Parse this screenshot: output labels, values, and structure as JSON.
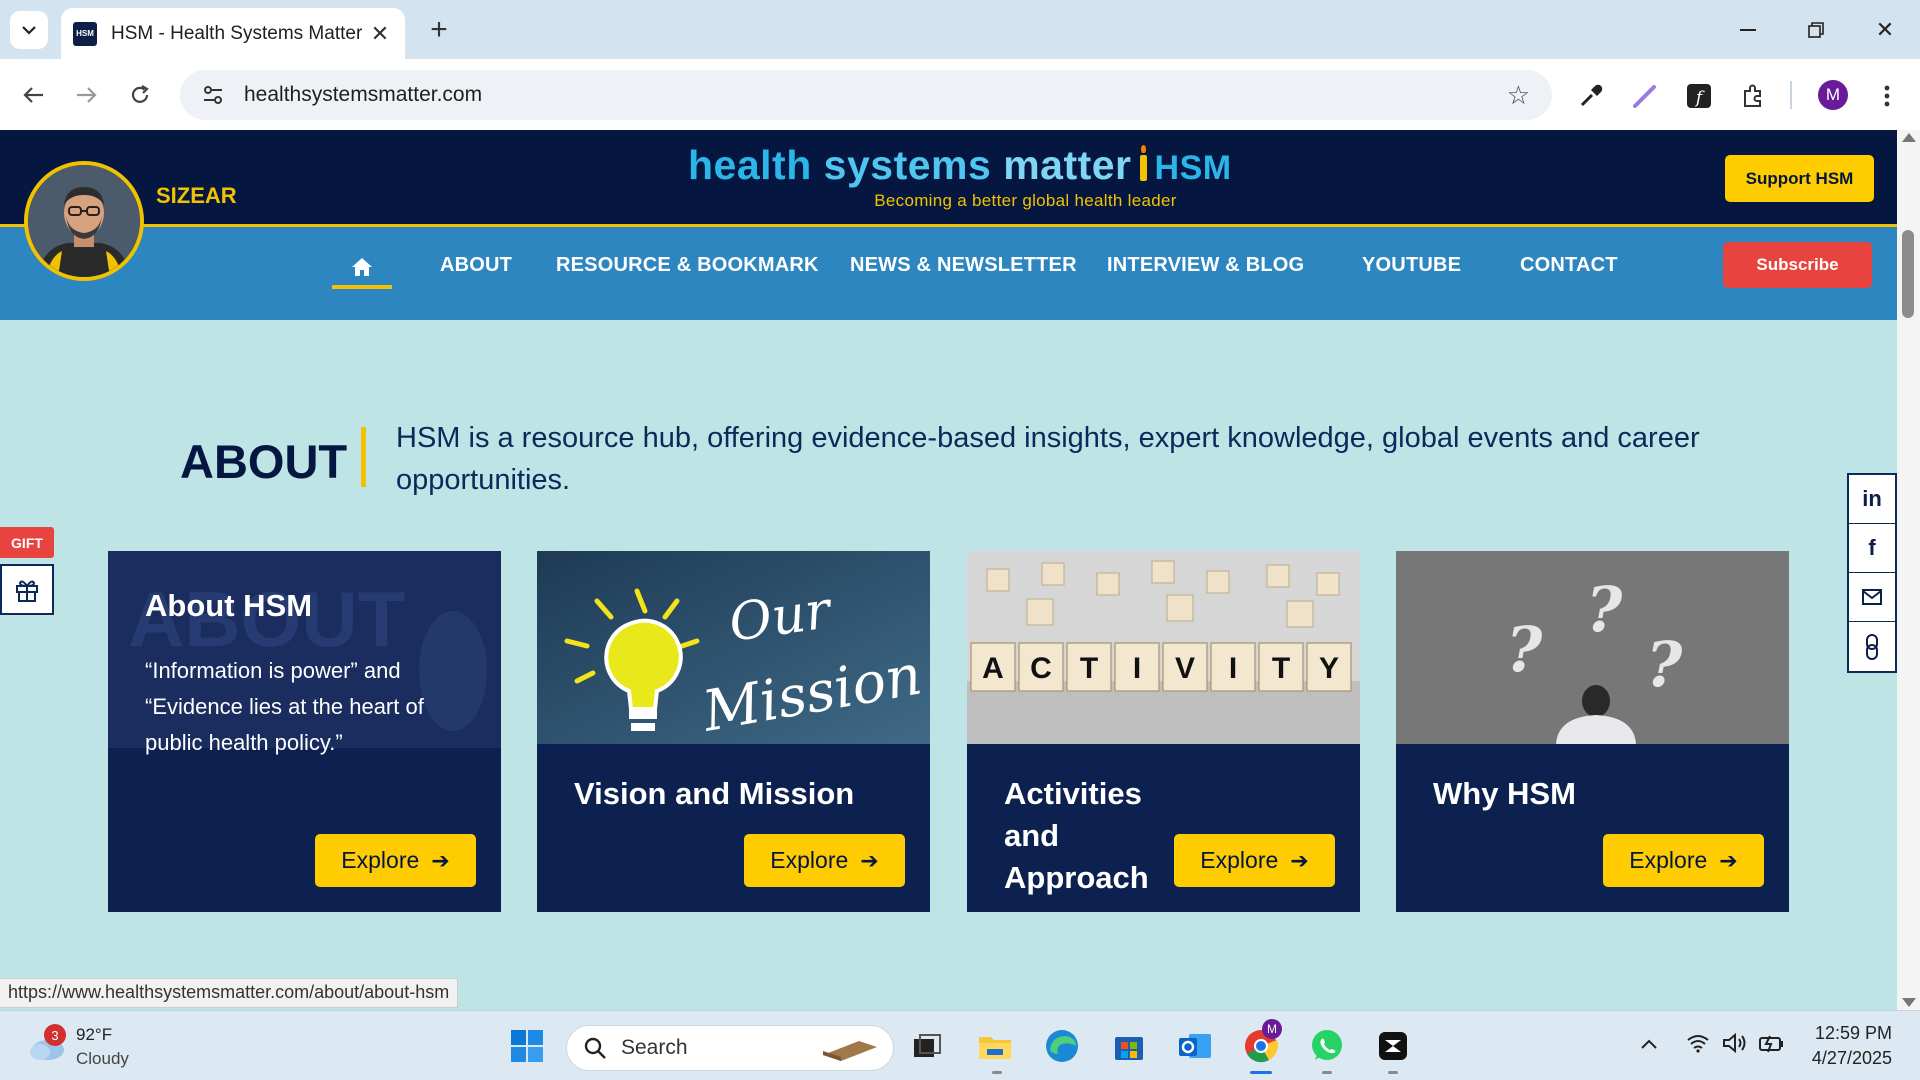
{
  "browser": {
    "tab_title": "HSM - Health Systems Matter",
    "favicon_text": "HSM",
    "url": "healthsystemsmatter.com",
    "profile_initial": "M",
    "status_url": "https://www.healthsystemsmatter.com/about/about-hsm"
  },
  "header": {
    "user_name": "SIZEAR",
    "logo_word1": "health",
    "logo_word2": "systems",
    "logo_word3": "matter",
    "logo_hsm": "HSM",
    "tagline": "Becoming a better global health leader",
    "support_label": "Support HSM"
  },
  "nav": {
    "items": [
      {
        "label": "ABOUT"
      },
      {
        "label": "RESOURCE & BOOKMARK"
      },
      {
        "label": "NEWS & NEWSLETTER"
      },
      {
        "label": "INTERVIEW & BLOG"
      },
      {
        "label": "YOUTUBE"
      },
      {
        "label": "CONTACT"
      }
    ],
    "subscribe_label": "Subscribe"
  },
  "about": {
    "heading": "ABOUT",
    "description": "HSM is a resource hub, offering evidence-based insights, expert knowledge, global events and career opportunities."
  },
  "cards": [
    {
      "title": "About HSM",
      "text": "“Information is power” and “Evidence lies at the heart of public health policy.”",
      "button": "Explore",
      "bg_word": "ABOUT"
    },
    {
      "title": "Vision and Mission",
      "button": "Explore",
      "img_text1": "Our",
      "img_text2": "Mission"
    },
    {
      "title": "Activities and Approach",
      "button": "Explore",
      "img_letters": [
        "A",
        "C",
        "T",
        "I",
        "V",
        "I",
        "T",
        "Y"
      ]
    },
    {
      "title": "Why HSM",
      "button": "Explore"
    }
  ],
  "gift": {
    "label": "GIFT"
  },
  "social": [
    "in",
    "f"
  ],
  "taskbar": {
    "temperature": "92°F",
    "condition": "Cloudy",
    "weather_badge": "3",
    "search_placeholder": "Search",
    "time": "12:59 PM",
    "date": "4/27/2025",
    "chrome_badge": "M"
  },
  "colors": {
    "header_bg": "#051640",
    "nav_bg": "#2e86c1",
    "page_bg": "#bfe4e6",
    "accent_yellow": "#ffcc00",
    "subscribe_red": "#e8433f",
    "card_bg": "#0d2150"
  }
}
